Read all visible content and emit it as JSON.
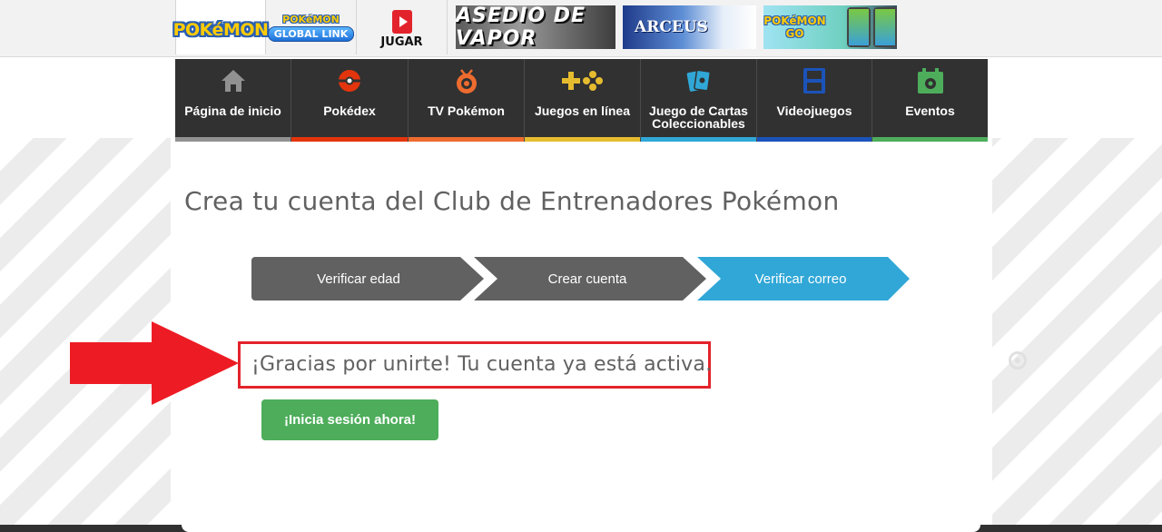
{
  "topbar": {
    "pokemon_logo": "POKéMON",
    "global_link_top": "POKéMON",
    "global_link_bottom": "GLOBAL LINK",
    "play_label": "JUGAR",
    "banners": {
      "asedio": "ASEDIO DE VAPOR",
      "arceus": "ARCEUS",
      "go_top": "POKéMON",
      "go_bottom": "GO"
    }
  },
  "nav": {
    "items": [
      {
        "label": "Página de inicio",
        "icon": "home-icon",
        "color": "#919191"
      },
      {
        "label": "Pokédex",
        "icon": "pokeball-icon",
        "color": "#e3350d"
      },
      {
        "label": "TV Pokémon",
        "icon": "tv-icon",
        "color": "#ee6b2f"
      },
      {
        "label": "Juegos en línea",
        "icon": "gamepad-icon",
        "color": "#e6bc2f"
      },
      {
        "label": "Juego de Cartas Coleccionables",
        "icon": "cards-icon",
        "color": "#30a7d7"
      },
      {
        "label": "Videojuegos",
        "icon": "ds-icon",
        "color": "#1b53ba"
      },
      {
        "label": "Eventos",
        "icon": "calendar-icon",
        "color": "#4dad5b"
      }
    ]
  },
  "main": {
    "title": "Crea tu cuenta del Club de Entrenadores Pokémon",
    "steps": [
      "Verificar edad",
      "Crear cuenta",
      "Verificar correo"
    ],
    "success_message": "¡Gracias por unirte! Tu cuenta ya está activa.",
    "login_button": "¡Inicia sesión ahora!"
  }
}
